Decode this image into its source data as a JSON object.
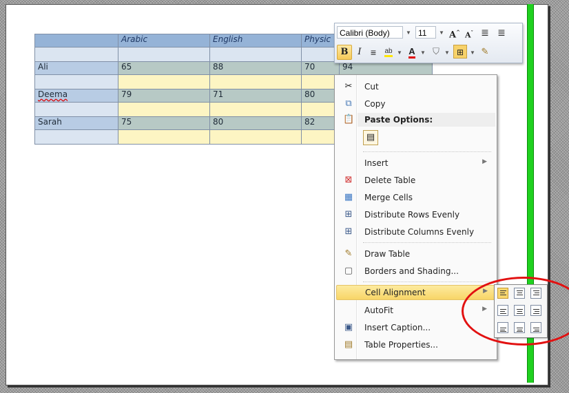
{
  "table": {
    "headers": [
      "",
      "Arabic",
      "English",
      "Physic",
      ""
    ],
    "rows": [
      {
        "name": "Ali",
        "values": [
          "65",
          "88",
          "70",
          "94"
        ]
      },
      {
        "name": "Deema",
        "values": [
          "79",
          "71",
          "80",
          ""
        ]
      },
      {
        "name": "Sarah",
        "values": [
          "75",
          "80",
          "82",
          ""
        ]
      }
    ]
  },
  "minibar": {
    "font_name": "Calibri (Body)",
    "font_size": "11",
    "bold": "B",
    "italic": "I"
  },
  "menu": {
    "cut": "Cut",
    "copy": "Copy",
    "paste_options": "Paste Options:",
    "insert": "Insert",
    "delete_table": "Delete Table",
    "merge_cells": "Merge Cells",
    "distribute_rows": "Distribute Rows Evenly",
    "distribute_columns": "Distribute Columns Evenly",
    "draw_table": "Draw Table",
    "borders_shading": "Borders and Shading...",
    "cell_alignment": "Cell Alignment",
    "autofit": "AutoFit",
    "insert_caption": "Insert Caption...",
    "table_properties": "Table Properties..."
  },
  "colors": {
    "highlight": "#f8d567",
    "annotation": "#e21111",
    "green_bar": "#1fd11f"
  }
}
